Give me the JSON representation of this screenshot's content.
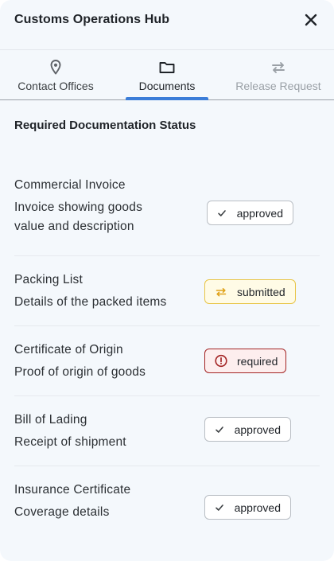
{
  "app": {
    "title": "Customs Operations Hub"
  },
  "tabs": [
    {
      "label": "Contact Offices",
      "icon": "location-pin-icon",
      "state": "normal"
    },
    {
      "label": "Documents",
      "icon": "folder-icon",
      "state": "active"
    },
    {
      "label": "Release Request",
      "icon": "swap-arrows-icon",
      "state": "disabled"
    }
  ],
  "section": {
    "title": "Required Documentation Status"
  },
  "documents": [
    {
      "name": "Commercial Invoice",
      "description": "Invoice showing goods value and description",
      "status": "approved",
      "status_icon": "check-icon"
    },
    {
      "name": "Packing List",
      "description": "Details of the packed items",
      "status": "submitted",
      "status_icon": "swap-arrows-icon"
    },
    {
      "name": "Certificate of Origin",
      "description": "Proof of origin of goods",
      "status": "required",
      "status_icon": "alert-circle-icon"
    },
    {
      "name": "Bill of Lading",
      "description": "Receipt of shipment",
      "status": "approved",
      "status_icon": "check-icon"
    },
    {
      "name": "Insurance Certificate",
      "description": "Coverage details",
      "status": "approved",
      "status_icon": "check-icon"
    }
  ],
  "colors": {
    "accent": "#3b7dd8",
    "approved_border": "#b9bec4",
    "submitted_bg": "#fffbe6",
    "submitted_border": "#e8c547",
    "submitted_icon": "#e0a21a",
    "required_bg": "#fdeeee",
    "required_border": "#a32424"
  }
}
